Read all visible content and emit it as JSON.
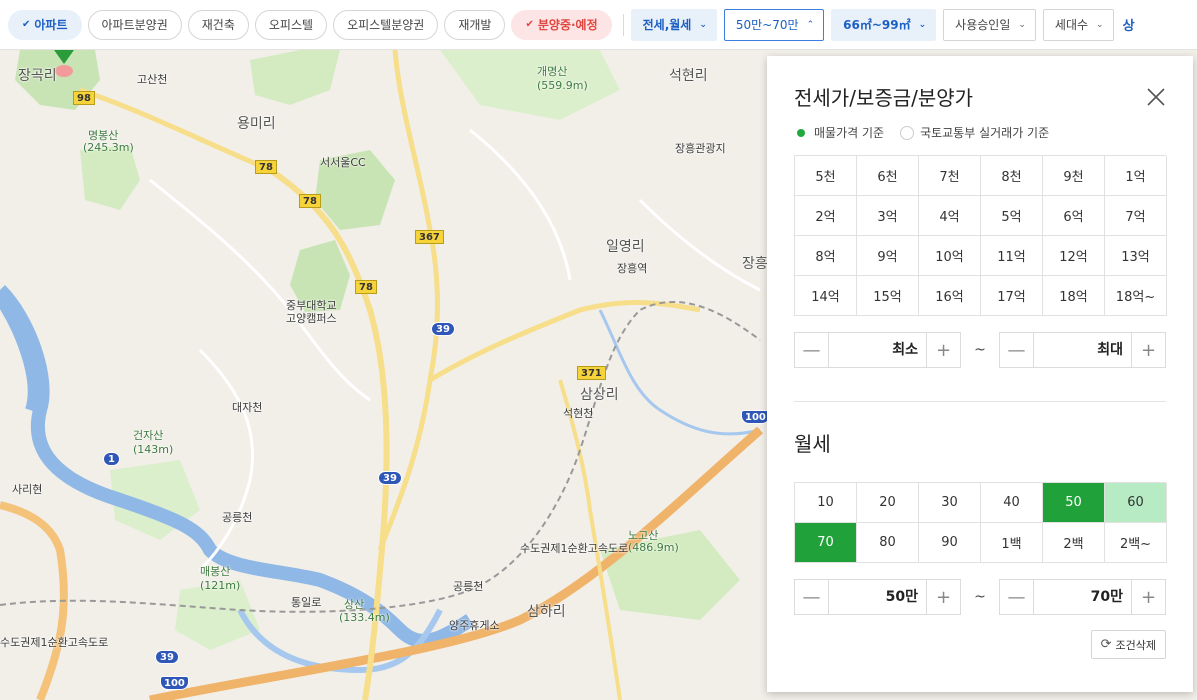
{
  "filters": {
    "chips": [
      {
        "label": "아파트",
        "state": "active",
        "check": "✔"
      },
      {
        "label": "아파트분양권",
        "state": "normal"
      },
      {
        "label": "재건축",
        "state": "normal"
      },
      {
        "label": "오피스텔",
        "state": "normal"
      },
      {
        "label": "오피스텔분양권",
        "state": "normal"
      },
      {
        "label": "재개발",
        "state": "normal"
      },
      {
        "label": "분양중·예정",
        "state": "pink",
        "check": "✔"
      }
    ],
    "dropdowns": [
      {
        "label": "전세,월세",
        "style": "blue",
        "chev": "⌄"
      },
      {
        "label": "50만~70만",
        "style": "outline",
        "chev": "⌃"
      },
      {
        "label": "66㎡~99㎡",
        "style": "blue",
        "chev": "⌄"
      },
      {
        "label": "사용승인일",
        "style": "plain",
        "chev": "⌄"
      },
      {
        "label": "세대수",
        "style": "plain",
        "chev": "⌄"
      }
    ],
    "cut_text": "상"
  },
  "map": {
    "labels": [
      {
        "text": "장곡리",
        "cls": "big"
      },
      {
        "text": "고산천",
        "cls": ""
      },
      {
        "text": "개명산",
        "cls": "mtn"
      },
      {
        "text": "(559.9m)",
        "cls": "mtn"
      },
      {
        "text": "석현리",
        "cls": "big"
      },
      {
        "text": "용미리",
        "cls": "big"
      },
      {
        "text": "명봉산",
        "cls": "mtn"
      },
      {
        "text": "(245.3m)",
        "cls": "mtn"
      },
      {
        "text": "서서울CC",
        "cls": ""
      },
      {
        "text": "장흥관광지",
        "cls": ""
      },
      {
        "text": "일영리",
        "cls": "big"
      },
      {
        "text": "장흥역",
        "cls": ""
      },
      {
        "text": "장흥",
        "cls": "big"
      },
      {
        "text": "중부대학교",
        "cls": ""
      },
      {
        "text": "고양캠퍼스",
        "cls": ""
      },
      {
        "text": "삼상리",
        "cls": "big"
      },
      {
        "text": "석현천",
        "cls": ""
      },
      {
        "text": "대자천",
        "cls": ""
      },
      {
        "text": "건자산",
        "cls": "mtn"
      },
      {
        "text": "(143m)",
        "cls": "mtn"
      },
      {
        "text": "사리현",
        "cls": ""
      },
      {
        "text": "공릉천",
        "cls": ""
      },
      {
        "text": "매봉산",
        "cls": "mtn"
      },
      {
        "text": "(121m)",
        "cls": "mtn"
      },
      {
        "text": "통일로",
        "cls": ""
      },
      {
        "text": "상산",
        "cls": "mtn"
      },
      {
        "text": "(133.4m)",
        "cls": "mtn"
      },
      {
        "text": "공릉천",
        "cls": ""
      },
      {
        "text": "양주휴게소",
        "cls": ""
      },
      {
        "text": "삼하리",
        "cls": "big"
      },
      {
        "text": "노고산",
        "cls": "mtn"
      },
      {
        "text": "(486.9m)",
        "cls": "mtn"
      },
      {
        "text": "수도권제1순환고속도로",
        "cls": ""
      },
      {
        "text": "수도권제1순환고속도로",
        "cls": ""
      }
    ],
    "route_numbers": [
      "98",
      "78",
      "78",
      "367",
      "78",
      "39",
      "371",
      "100",
      "39",
      "39",
      "100",
      "1"
    ]
  },
  "panel": {
    "title": "전세가/보증금/분양가",
    "radios": [
      {
        "label": "매물가격 기준",
        "on": true
      },
      {
        "label": "국토교통부 실거래가 기준",
        "on": false
      }
    ],
    "price_grid": [
      "5천",
      "6천",
      "7천",
      "8천",
      "9천",
      "1억",
      "2억",
      "3억",
      "4억",
      "5억",
      "6억",
      "7억",
      "8억",
      "9억",
      "10억",
      "11억",
      "12억",
      "13억",
      "14억",
      "15억",
      "16억",
      "17억",
      "18억",
      "18억~"
    ],
    "price_min": "최소",
    "price_max": "최대",
    "tilde": "~",
    "monthly_title": "월세",
    "monthly_grid": [
      {
        "label": "10",
        "state": ""
      },
      {
        "label": "20",
        "state": ""
      },
      {
        "label": "30",
        "state": ""
      },
      {
        "label": "40",
        "state": ""
      },
      {
        "label": "50",
        "state": "sel"
      },
      {
        "label": "60",
        "state": "range"
      },
      {
        "label": "70",
        "state": "sel"
      },
      {
        "label": "80",
        "state": ""
      },
      {
        "label": "90",
        "state": ""
      },
      {
        "label": "1백",
        "state": ""
      },
      {
        "label": "2백",
        "state": ""
      },
      {
        "label": "2백~",
        "state": ""
      }
    ],
    "monthly_min": "50만",
    "monthly_max": "70만",
    "minus": "—",
    "plus": "+",
    "reset_label": "조건삭제",
    "reset_icon": "⟳"
  },
  "colors": {
    "selected": "#21a13a",
    "range": "#b6ebc3",
    "accent_blue": "#1c5fc4",
    "pink": "#e0463f"
  }
}
